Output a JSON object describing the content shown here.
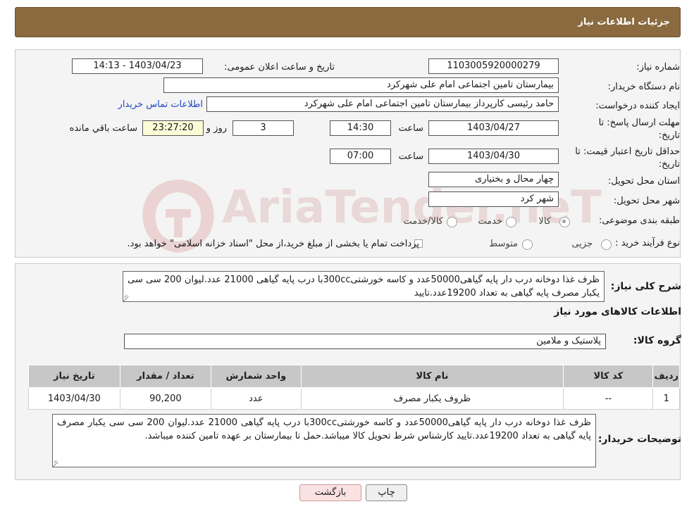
{
  "header": {
    "title": "جزئیات اطلاعات نیاز"
  },
  "form": {
    "need_number_label": "شماره نیاز:",
    "need_number": "1103005920000279",
    "announce_label": "تاریخ و ساعت اعلان عمومی:",
    "announce_value": "1403/04/23 - 14:13",
    "buyer_org_label": "نام دستگاه خریدار:",
    "buyer_org": "بیمارستان تامین اجتماعی امام علی شهرکرد",
    "creator_label": "ایجاد کننده درخواست:",
    "creator": "حامد رئیسی کارپرداز بیمارستان تامین اجتماعی امام علی شهرکرد",
    "contact_link": "اطلاعات تماس خریدار",
    "deadline_label_1": "مهلت ارسال پاسخ: تا",
    "deadline_label_2": "تاریخ:",
    "deadline_date": "1403/04/27",
    "time_label": "ساعت",
    "deadline_time": "14:30",
    "days_value": "3",
    "days_label": "روز و",
    "remaining_time": "23:27:20",
    "remaining_label": "ساعت باقي مانده",
    "validity_label_1": "حداقل تاریخ اعتبار قیمت: تا",
    "validity_label_2": "تاریخ:",
    "validity_date": "1403/04/30",
    "validity_time_label": "ساعت",
    "validity_time": "07:00",
    "province_label": "استان محل تحویل:",
    "province": "چهار محال و بختیاری",
    "city_label": "شهر محل تحویل:",
    "city": "شهر کرد",
    "category_label": "طبقه بندی موضوعی:",
    "category_options": [
      "کالا",
      "خدمت",
      "کالا/خدمت"
    ],
    "process_label": "نوع فرآیند خرید :",
    "process_options": [
      "جزیی",
      "متوسط"
    ],
    "process_note": "پرداخت تمام یا بخشی از مبلغ خرید،از محل \"اسناد خزانه اسلامی\" خواهد بود."
  },
  "details": {
    "summary_label": "شرح کلی نیاز:",
    "summary_text": "ظرف غذا دوخانه درب دار پایه گیاهی50000عدد و کاسه خورشتی300ccبا درب پایه گیاهی 21000 عدد.لیوان 200 سی سی یکبار مصرف پایه گیاهی به تعداد 19200عدد.تایید",
    "goods_info_heading": "اطلاعات کالاهای مورد نیاز",
    "goods_group_label": "گروه کالا:",
    "goods_group": "پلاستیک و ملامین",
    "table": {
      "headers": [
        "ردیف",
        "کد کالا",
        "نام کالا",
        "واحد شمارش",
        "تعداد / مقدار",
        "تاریخ نیاز"
      ],
      "rows": [
        [
          "1",
          "--",
          "ظروف یکبار مصرف",
          "عدد",
          "90,200",
          "1403/04/30"
        ]
      ]
    },
    "buyer_notes_label": "توضیحات خریدار:",
    "buyer_notes": "ظرف غذا دوخانه درب دار پایه گیاهی50000عدد و کاسه خورشتی300ccبا درب پایه گیاهی 21000 عدد.لیوان 200 سی سی یکبار مصرف پایه گیاهی به تعداد 19200عدد.تایید کارشناس شرط تحویل کالا میباشد.حمل تا بیمارستان بر عهده تامین کننده میباشد."
  },
  "buttons": {
    "print": "چاپ",
    "back": "بازگشت"
  },
  "watermark": {
    "text": "AriaTender.neT"
  },
  "colors": {
    "title_bg": "#8a6a3e",
    "link": "#1f47c8",
    "remaining_bg": "#fbfbd6",
    "table_header": "#c7c7c7"
  }
}
